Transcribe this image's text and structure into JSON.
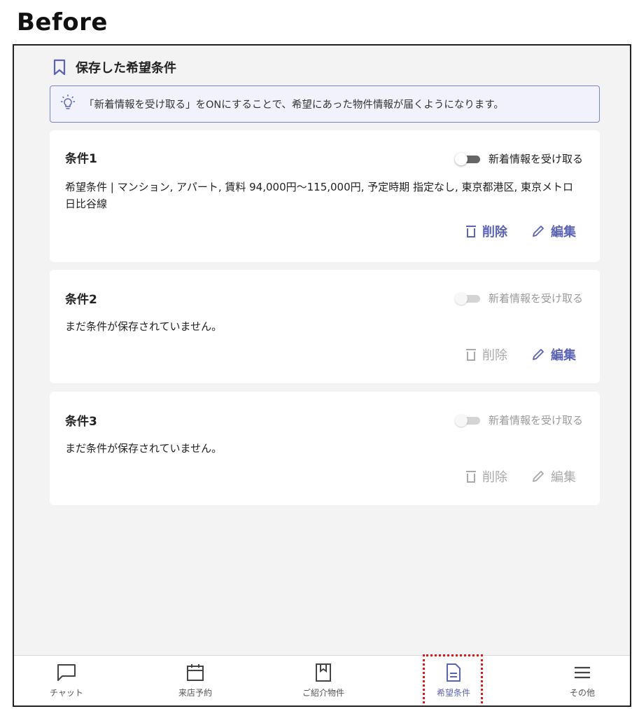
{
  "label": "Before",
  "header": {
    "title": "保存した希望条件"
  },
  "banner": {
    "text": "「新着情報を受け取る」をONにすることで、希望にあった物件情報が届くようになります。"
  },
  "cards": [
    {
      "title": "条件1",
      "toggle_label": "新着情報を受け取る",
      "desc": "希望条件 | マンション, アパート, 賃料 94,000円〜115,000円, 予定時期 指定なし, 東京都港区, 東京メトロ日比谷線",
      "delete_label": "削除",
      "edit_label": "編集"
    },
    {
      "title": "条件2",
      "toggle_label": "新着情報を受け取る",
      "desc": "まだ条件が保存されていません。",
      "delete_label": "削除",
      "edit_label": "編集"
    },
    {
      "title": "条件3",
      "toggle_label": "新着情報を受け取る",
      "desc": "まだ条件が保存されていません。",
      "delete_label": "削除",
      "edit_label": "編集"
    }
  ],
  "tabs": [
    {
      "label": "チャット",
      "icon": "chat-icon"
    },
    {
      "label": "来店予約",
      "icon": "calendar-icon"
    },
    {
      "label": "ご紹介物件",
      "icon": "bookmark-icon"
    },
    {
      "label": "希望条件",
      "icon": "document-icon",
      "active": true
    },
    {
      "label": "その他",
      "icon": "menu-icon"
    }
  ],
  "colors": {
    "accent": "#5b63b5",
    "highlight": "#e01818",
    "background": "#f3f3f4"
  }
}
